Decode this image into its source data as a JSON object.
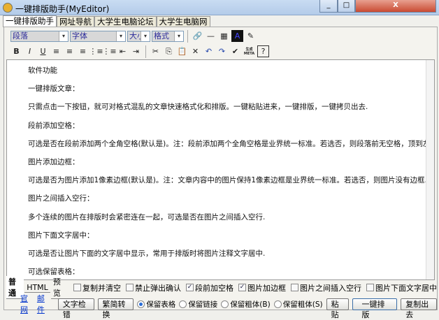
{
  "window": {
    "title": "一键排版助手(MyEditor)",
    "min": "_",
    "max": "□",
    "close": "X"
  },
  "tabs": [
    "一键排版助手",
    "网址导航",
    "大学生电脑论坛",
    "大学生电脑网"
  ],
  "toolbar": {
    "paragraph": "段落",
    "font": "字体",
    "size": "大小",
    "format": "格式",
    "dd": "▾",
    "row1_icons": [
      "🔗",
      "—",
      "▦",
      "A",
      "✎"
    ],
    "row2_icons": [
      "B",
      "I",
      "U",
      "≡",
      "≡",
      "≡",
      "⋮≡",
      "⋮≡",
      "⇤",
      "⇥",
      "✂",
      "⎘",
      "📋",
      "✕",
      "↶",
      "↷",
      "✔",
      "生成META",
      "?"
    ]
  },
  "content": [
    "软件功能",
    "一键排版文章：",
    "只需点击一下按钮，就可对格式混乱的文章快速格式化和排版。一键粘贴进来，一键排版，一键拷贝出去.",
    "段前添加空格：",
    "可选是否在段前添加两个全角空格(默认是)。注：段前添加两个全角空格是业界统一标准。若选否，则段落前无空格，顶到左侧.",
    "图片添加边框：",
    "可选是否为图片添加1像素边框(默认是)。注：文章内容中的图片保持1像素边框是业界统一标准。若选否，则图片没有边框.",
    "图片之间插入空行：",
    "多个连续的图片在排版时会紧密连在一起，可选是否在图片之间插入空行.",
    "图片下面文字居中：",
    "可选是否让图片下面的文字居中显示，常用于排版时将图片注释文字居中.",
    "可选保留表格："
  ],
  "view_tabs": [
    "普通",
    "HTML",
    "预览"
  ],
  "options": [
    {
      "label": "复制并清空",
      "checked": false
    },
    {
      "label": "禁止弹出确认",
      "checked": false
    },
    {
      "label": "段前加空格",
      "checked": true
    },
    {
      "label": "图片加边框",
      "checked": true
    },
    {
      "label": "图片之间插入空行",
      "checked": false
    },
    {
      "label": "图片下面文字居中",
      "checked": false
    }
  ],
  "links": {
    "site": "官网",
    "mail": "邮件"
  },
  "buttons": {
    "spellcheck": "文字检错",
    "convert": "繁简转换",
    "paste": "粘贴",
    "format": "一键排版",
    "copy_out": "复制出去"
  },
  "radios": [
    {
      "label": "保留表格",
      "checked": true
    },
    {
      "label": "保留链接",
      "checked": false
    },
    {
      "label": "保留粗体(B)",
      "checked": false
    },
    {
      "label": "保留粗体(S)",
      "checked": false
    }
  ]
}
